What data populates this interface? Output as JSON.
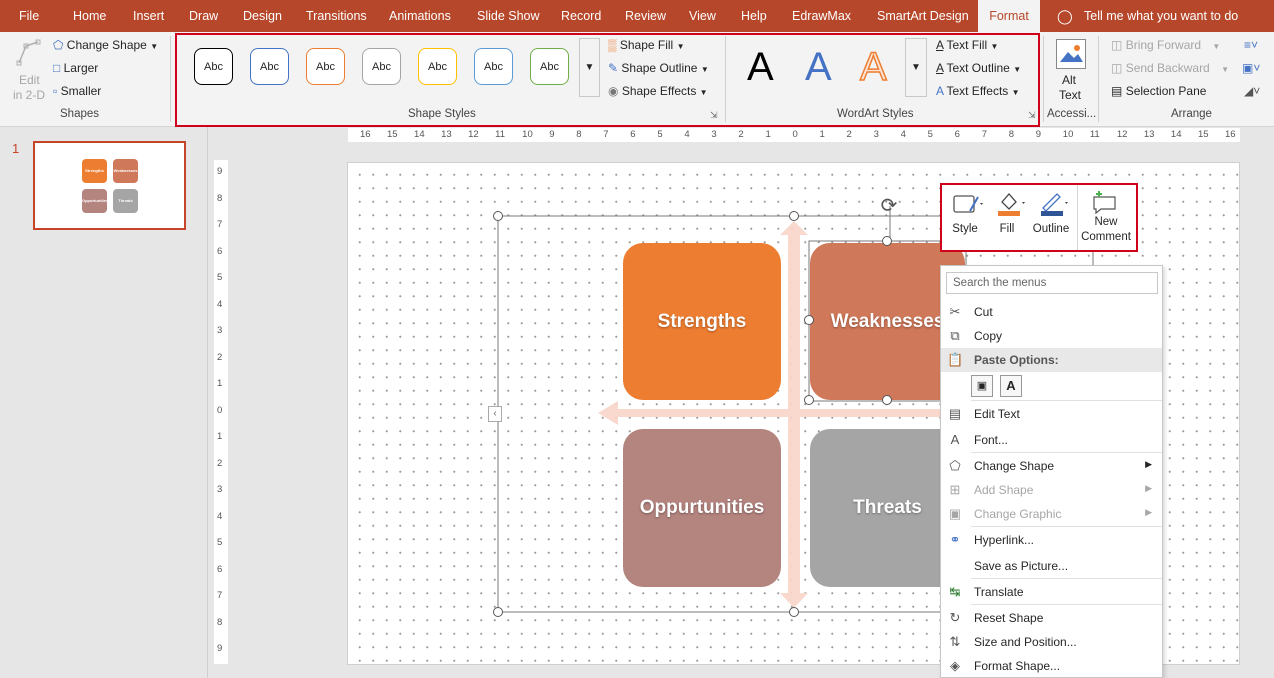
{
  "tabs": {
    "file": "File",
    "home": "Home",
    "insert": "Insert",
    "draw": "Draw",
    "design": "Design",
    "transitions": "Transitions",
    "animations": "Animations",
    "slideshow": "Slide Show",
    "record": "Record",
    "review": "Review",
    "view": "View",
    "help": "Help",
    "edrawmax": "EdrawMax",
    "smartart_design": "SmartArt Design",
    "format": "Format",
    "tellme": "Tell me what you want to do"
  },
  "ribbon": {
    "shapes": {
      "edit_2d_line1": "Edit",
      "edit_2d_line2": "in 2-D",
      "change_shape": "Change Shape",
      "larger": "Larger",
      "smaller": "Smaller",
      "group_label": "Shapes"
    },
    "shape_styles": {
      "gallery": [
        {
          "label": "Abc",
          "border": "#000000"
        },
        {
          "label": "Abc",
          "border": "#4472c4"
        },
        {
          "label": "Abc",
          "border": "#ed7d31"
        },
        {
          "label": "Abc",
          "border": "#a5a5a5"
        },
        {
          "label": "Abc",
          "border": "#ffc000"
        },
        {
          "label": "Abc",
          "border": "#5b9bd5"
        },
        {
          "label": "Abc",
          "border": "#70ad47"
        }
      ],
      "fill": "Shape Fill",
      "outline": "Shape Outline",
      "effects": "Shape Effects",
      "group_label": "Shape Styles"
    },
    "wordart": {
      "letters": [
        "A",
        "A",
        "A"
      ],
      "text_fill": "Text Fill",
      "text_outline": "Text Outline",
      "text_effects": "Text Effects",
      "group_label": "WordArt Styles"
    },
    "accessibility": {
      "alt_line1": "Alt",
      "alt_line2": "Text",
      "group_label": "Accessi..."
    },
    "arrange": {
      "bring_forward": "Bring Forward",
      "send_backward": "Send Backward",
      "selection_pane": "Selection Pane",
      "group_label": "Arrange"
    }
  },
  "thumbnail": {
    "slide_number": "1",
    "labels": [
      "Strengths",
      "Weaknesses",
      "Opportunities",
      "Threats"
    ]
  },
  "rulers": {
    "horizontal": [
      "16",
      "15",
      "14",
      "13",
      "12",
      "11",
      "10",
      "9",
      "8",
      "7",
      "6",
      "5",
      "4",
      "3",
      "2",
      "1",
      "0",
      "1",
      "2",
      "3",
      "4",
      "5",
      "6",
      "7",
      "8",
      "9",
      "10",
      "11",
      "12",
      "13",
      "14",
      "15",
      "16"
    ],
    "vertical": [
      "9",
      "8",
      "7",
      "6",
      "5",
      "4",
      "3",
      "2",
      "1",
      "0",
      "1",
      "2",
      "3",
      "4",
      "5",
      "6",
      "7",
      "8",
      "9"
    ]
  },
  "smartart": {
    "strengths": "Strengths",
    "weaknesses": "Weaknesses",
    "opportunities": "Oppurtunities",
    "threats": "Threats",
    "colors": {
      "strengths": "#ed7d31",
      "weaknesses": "#d0785a",
      "opportunities": "#b4847f",
      "threats": "#a5a5a5",
      "arrows": "#f8d4c8"
    }
  },
  "mini_toolbar": {
    "style": "Style",
    "fill": "Fill",
    "outline": "Outline",
    "new_comment_line1": "New",
    "new_comment_line2": "Comment"
  },
  "context_menu": {
    "search_placeholder": "Search the menus",
    "cut": "Cut",
    "copy": "Copy",
    "paste_options": "Paste Options:",
    "edit_text": "Edit Text",
    "font": "Font...",
    "change_shape": "Change Shape",
    "add_shape": "Add Shape",
    "change_graphic": "Change Graphic",
    "hyperlink": "Hyperlink...",
    "save_as_picture": "Save as Picture...",
    "translate": "Translate",
    "reset_shape": "Reset Shape",
    "size_and_position": "Size and Position...",
    "format_shape": "Format Shape..."
  }
}
